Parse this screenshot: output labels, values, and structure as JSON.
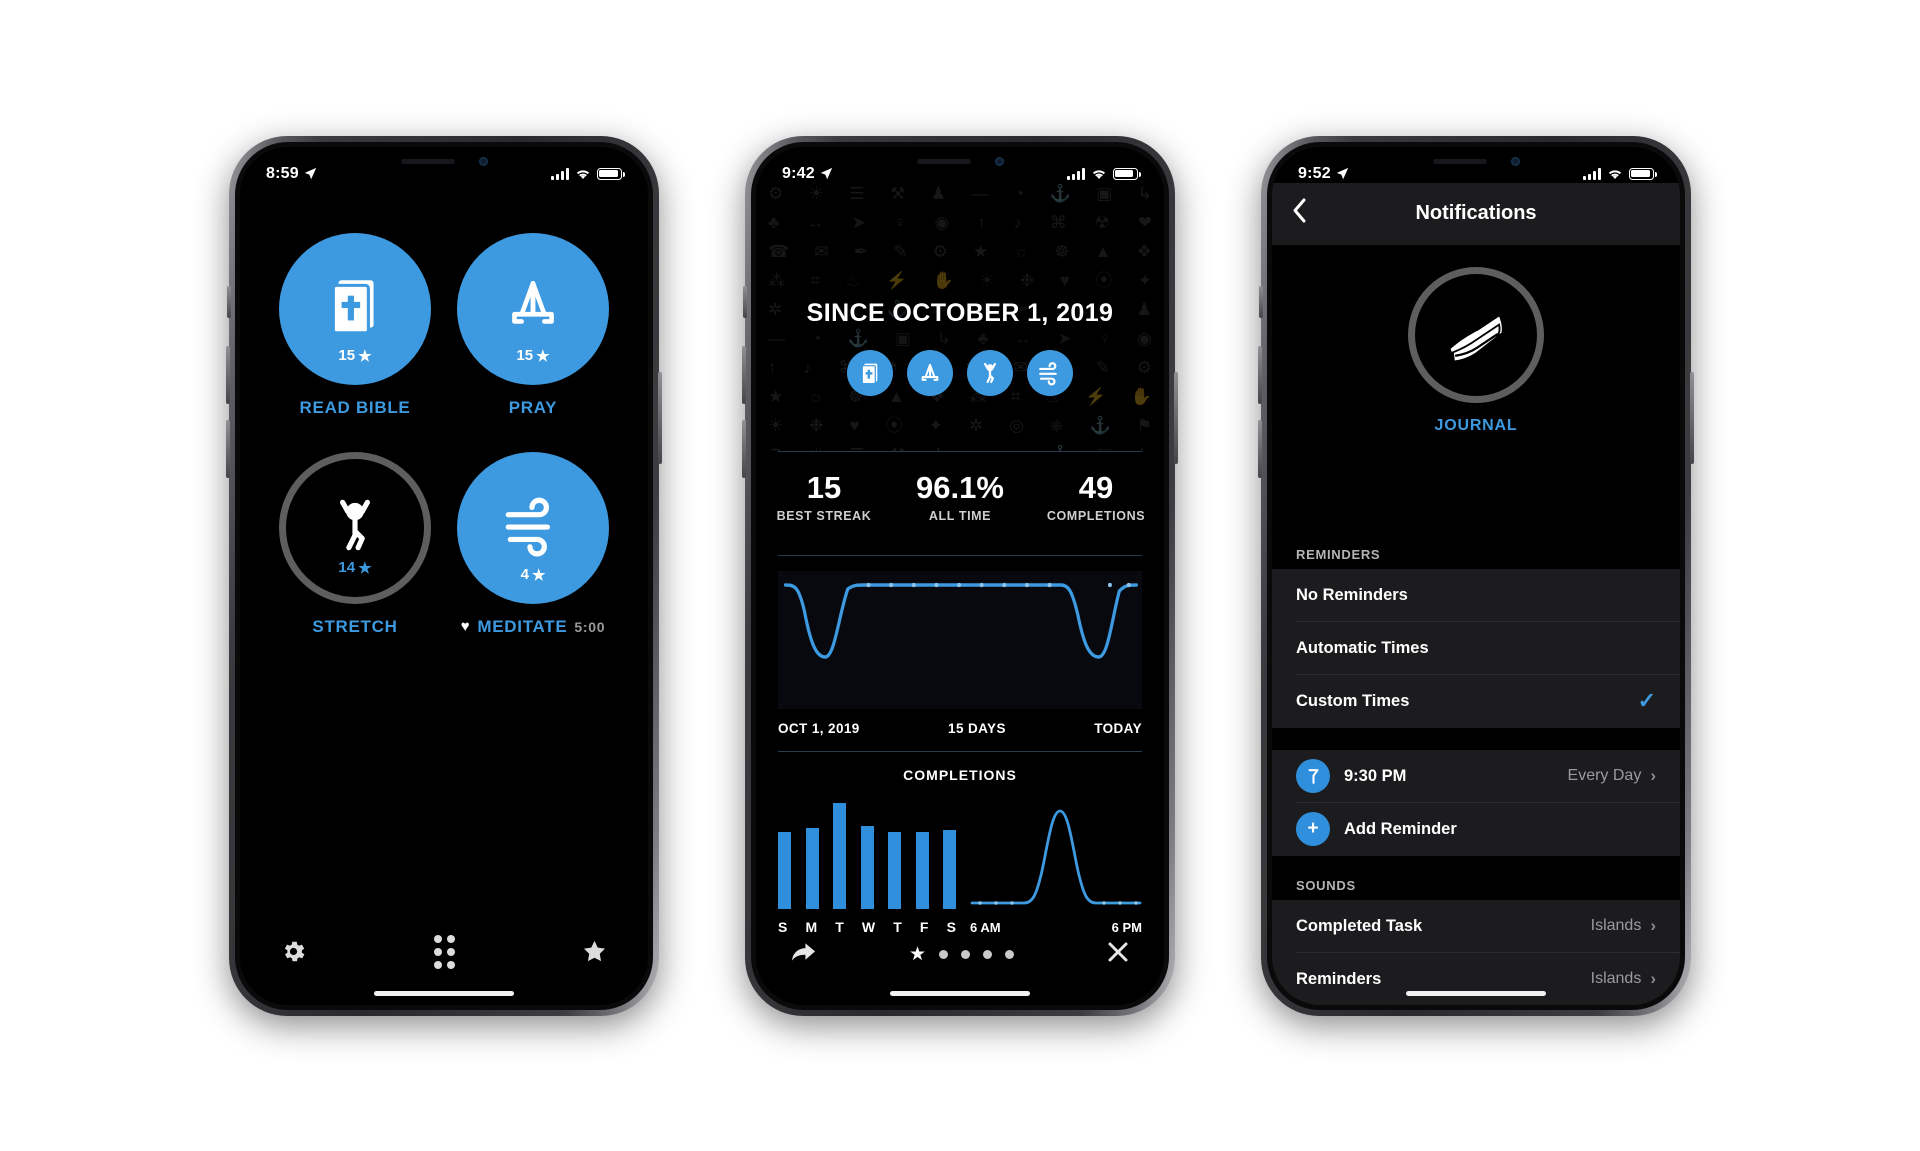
{
  "phone1": {
    "status": {
      "time": "8:59",
      "location_icon": "location-arrow-icon",
      "signal_icon": "cellular-bars-icon",
      "wifi_icon": "wifi-icon",
      "battery_icon": "battery-icon"
    },
    "habits": [
      {
        "label": "READ BIBLE",
        "streak": "15",
        "star": "★",
        "state": "completed",
        "icon": "bible-book-icon"
      },
      {
        "label": "PRAY",
        "streak": "15",
        "star": "★",
        "state": "completed",
        "icon": "praying-hands-icon"
      },
      {
        "label": "STRETCH",
        "streak": "14",
        "star": "★",
        "state": "incomplete",
        "icon": "stretch-person-icon"
      },
      {
        "label": "MEDITATE",
        "streak": "4",
        "star": "★",
        "state": "completed",
        "icon": "wind-icon",
        "heart": "♥",
        "duration": "5:00"
      }
    ],
    "tabbar": [
      {
        "name": "settings-gear-icon",
        "label": "gear-icon"
      },
      {
        "name": "grid-dots-icon",
        "label": "dots-icon"
      },
      {
        "name": "star-icon",
        "label": "star-icon"
      }
    ]
  },
  "phone2": {
    "status": {
      "time": "9:42"
    },
    "title": "SINCE OCTOBER 1, 2019",
    "habit_icons": [
      "bible-book-icon",
      "praying-hands-icon",
      "stretch-person-icon",
      "wind-icon"
    ],
    "stats": [
      {
        "value": "15",
        "label": "BEST STREAK"
      },
      {
        "value": "96.1%",
        "label": "ALL TIME"
      },
      {
        "value": "49",
        "label": "COMPLETIONS"
      }
    ],
    "axis": {
      "left": "OCT 1, 2019",
      "center": "15 DAYS",
      "right": "TODAY"
    },
    "completions_title": "COMPLETIONS",
    "time_axis": {
      "left": "6 AM",
      "right": "6 PM"
    },
    "bottom": {
      "share_icon": "share-arrow-icon",
      "close_icon": "close-x-icon",
      "star_icon": "star-icon",
      "dots": 4
    },
    "chart_data": [
      {
        "type": "line",
        "title": "",
        "x": [
          "OCT 1, 2019",
          "15 DAYS",
          "TODAY"
        ],
        "xlabel": "",
        "ylabel": "",
        "series": [
          {
            "name": "completion rate",
            "values": [
              100,
              98,
              55,
              30,
              96,
              100,
              100,
              100,
              100,
              100,
              100,
              100,
              100,
              100,
              100,
              100,
              96,
              55,
              42,
              78,
              100,
              100,
              100,
              100
            ]
          }
        ],
        "ylim": [
          0,
          100
        ],
        "grid": false
      },
      {
        "type": "bar",
        "title": "COMPLETIONS",
        "categories": [
          "S",
          "M",
          "T",
          "W",
          "T",
          "F",
          "S"
        ],
        "values": [
          72,
          76,
          100,
          78,
          72,
          72,
          74
        ],
        "xlabel": "",
        "ylabel": "",
        "ylim": [
          0,
          100
        ],
        "grid": false
      },
      {
        "type": "line",
        "title": "",
        "x": [
          "6 AM",
          "6 PM"
        ],
        "series": [
          {
            "name": "time of day",
            "values": [
              3,
              3,
              4,
              6,
              12,
              34,
              72,
              96,
              70,
              30,
              10,
              4,
              3,
              3,
              3,
              3
            ]
          }
        ],
        "ylim": [
          0,
          100
        ],
        "grid": false
      }
    ]
  },
  "phone3": {
    "status": {
      "time": "9:52"
    },
    "navbar": {
      "back_icon": "chevron-left-icon",
      "title": "Notifications"
    },
    "journal": {
      "icon": "journal-book-icon",
      "label": "JOURNAL"
    },
    "reminders_header": "REMINDERS",
    "reminder_modes": [
      {
        "label": "No Reminders",
        "selected": false
      },
      {
        "label": "Automatic Times",
        "selected": false
      },
      {
        "label": "Custom Times",
        "selected": true,
        "check": "✓"
      }
    ],
    "reminder_items": [
      {
        "icon": "clock-icon",
        "label": "9:30 PM",
        "value": "Every Day",
        "chevron": "›"
      },
      {
        "icon": "plus-icon",
        "label": "Add Reminder",
        "value": "",
        "chevron": ""
      }
    ],
    "sounds_header": "SOUNDS",
    "sound_items": [
      {
        "label": "Completed Task",
        "value": "Islands",
        "chevron": "›"
      },
      {
        "label": "Reminders",
        "value": "Islands",
        "chevron": "›"
      }
    ]
  },
  "colors": {
    "accent": "#3d9ae0",
    "bar": "#2f8fdc",
    "panel": "#1c1c1e",
    "background": "#000000"
  }
}
